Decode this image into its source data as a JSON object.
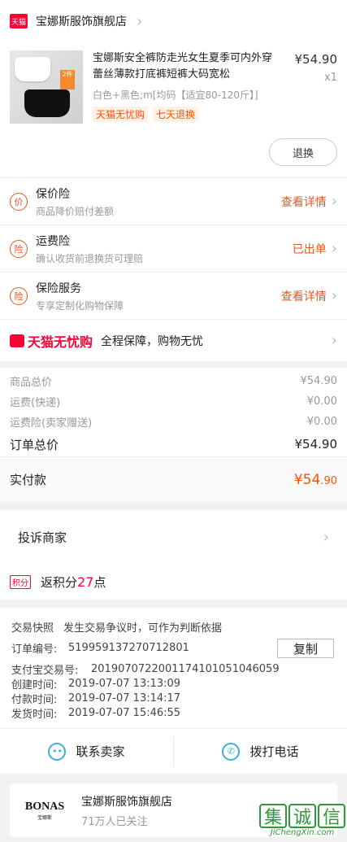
{
  "shop": {
    "badge": "天猫",
    "name": "宝娜斯服饰旗舰店"
  },
  "product": {
    "title": "宝娜斯安全裤防走光女生夏季可内外穿蕾丝薄款打底裤短裤大码宽松",
    "sku": "白色+黑色;m[均码【适宜80-120斤】]",
    "tags": [
      "天猫无忧购",
      "七天退换"
    ],
    "price": "¥54.90",
    "qty": "x1",
    "thumb_tag": "2件",
    "refund_label": "退换"
  },
  "insurance": [
    {
      "icon": "价",
      "title": "保价险",
      "sub": "商品降价赔付差额",
      "action": "查看详情"
    },
    {
      "icon": "险",
      "title": "运费险",
      "sub": "确认收货前退换货可理赔",
      "action": "已出单"
    },
    {
      "icon": "险",
      "title": "保险服务",
      "sub": "专享定制化购物保障",
      "action": "查看详情"
    }
  ],
  "wuyou": {
    "logo": "天猫无忧购",
    "text": "全程保障，购物无忧"
  },
  "summary": {
    "lines": [
      {
        "label": "商品总价",
        "value": "¥54.90"
      },
      {
        "label": "运费(快递)",
        "value": "¥0.00"
      },
      {
        "label": "运费险(卖家赠送)",
        "value": "¥0.00"
      }
    ],
    "total_label": "订单总价",
    "total_value": "¥54.90",
    "paid_label": "实付款",
    "paid_main": "¥54",
    "paid_cents": ".90"
  },
  "complain": {
    "label": "投诉商家"
  },
  "points": {
    "badge": "积分",
    "prefix": "返积分",
    "num": "27",
    "suffix": "点"
  },
  "order_info": {
    "snapshot_k": "交易快照",
    "snapshot_v": "发生交易争议时，可作为判断依据",
    "copy_label": "复制",
    "lines": [
      {
        "k": "订单编号:",
        "v": "519959137270712801"
      },
      {
        "k": "支付宝交易号:",
        "v": "2019070722001174101051046059"
      },
      {
        "k": "创建时间:",
        "v": "2019-07-07 13:13:09"
      },
      {
        "k": "付款时间:",
        "v": "2019-07-07 13:14:17"
      },
      {
        "k": "发货时间:",
        "v": "2019-07-07 15:46:55"
      }
    ]
  },
  "contact": {
    "seller_label": "联系卖家",
    "phone_label": "拨打电话"
  },
  "shop_card": {
    "logo": "BONAS",
    "logo_sub": "宝娜斯",
    "name": "宝娜斯服饰旗舰店",
    "followers": "71万人已关注"
  },
  "watermark": {
    "chars": [
      "集",
      "诚",
      "信"
    ],
    "url": "JiChengXin.com"
  }
}
